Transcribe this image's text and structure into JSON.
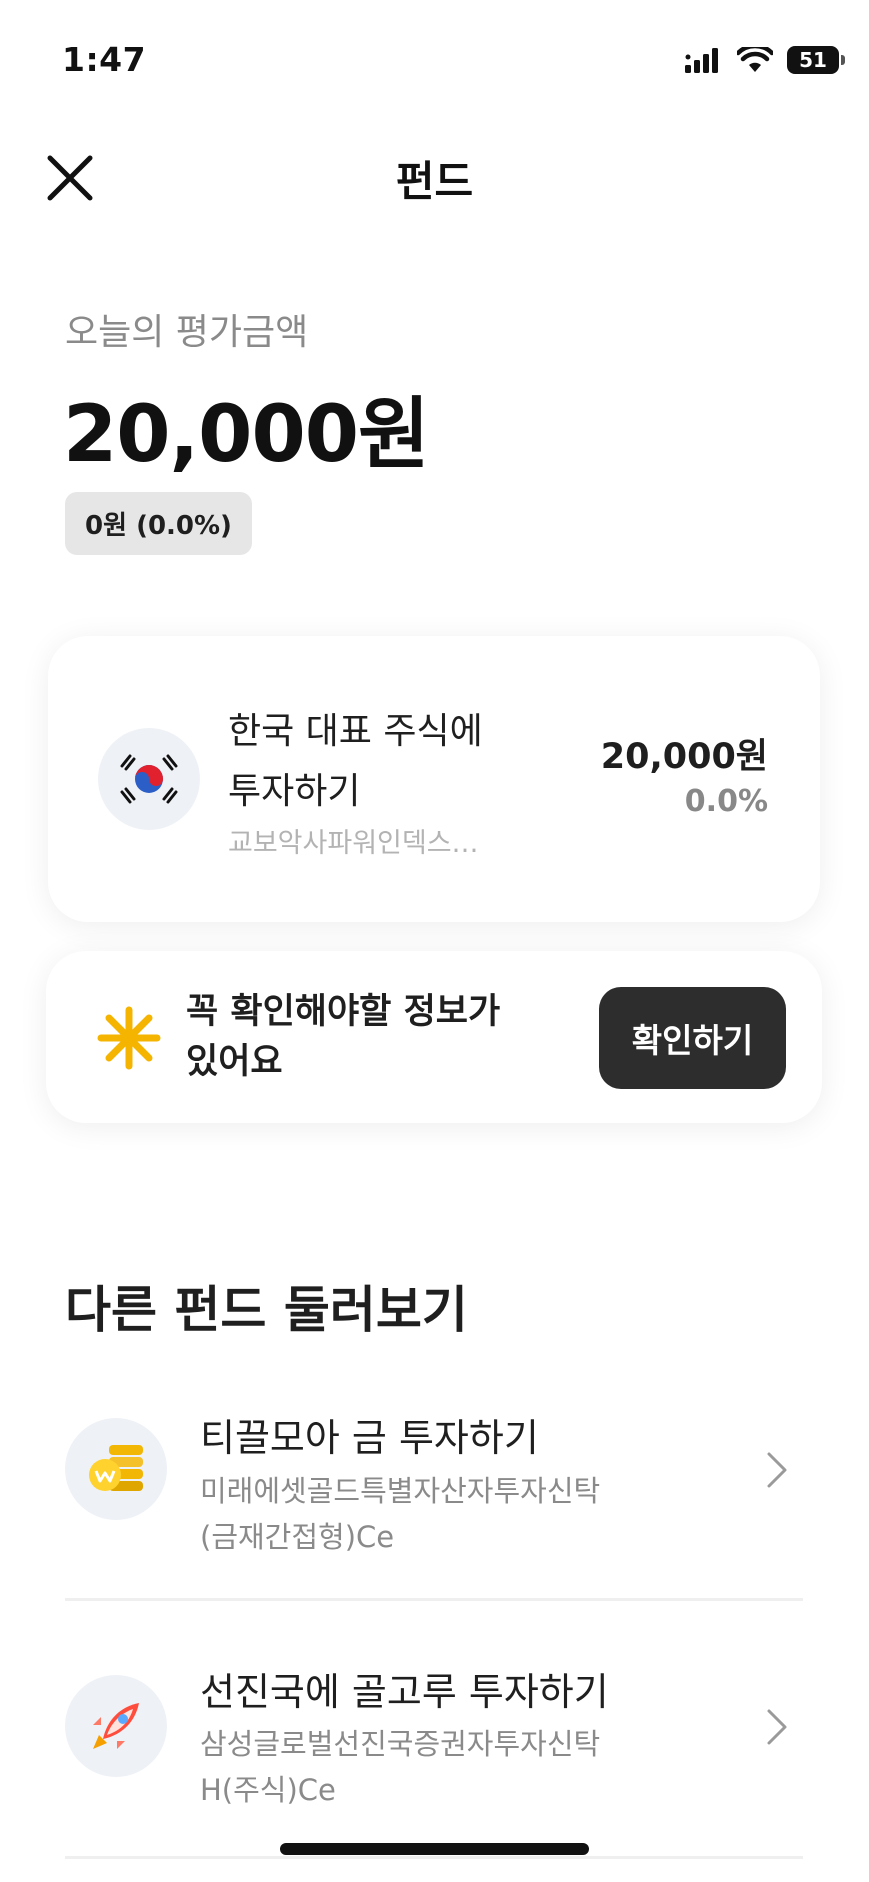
{
  "status_bar": {
    "time": "1:47",
    "battery": "51"
  },
  "header": {
    "title": "펀드"
  },
  "evaluation": {
    "label": "오늘의 평가금액",
    "amount": "20,000원",
    "change": "0원 (0.0%)"
  },
  "holding": {
    "title_line1": "한국 대표 주식에",
    "title_line2": "투자하기",
    "subtitle": "교보악사파워인덱스…",
    "value": "20,000원",
    "rate": "0.0%",
    "icon": "korea-flag-icon"
  },
  "notice": {
    "line1": "꼭 확인해야할 정보가",
    "line2": "있어요",
    "button": "확인하기",
    "icon": "sun-icon",
    "icon_color": "#f5b400"
  },
  "section": {
    "title": "다른 펀드 둘러보기"
  },
  "funds": [
    {
      "name": "티끌모아 금 투자하기",
      "sub_line1": "미래에셋골드특별자산자투자신탁",
      "sub_line2": "(금재간접형)Ce",
      "icon": "gold-coins-icon"
    },
    {
      "name": "선진국에 골고루 투자하기",
      "sub_line1": "삼성글로벌선진국증권자투자신탁",
      "sub_line2": "H(주식)Ce",
      "icon": "rocket-icon"
    }
  ]
}
